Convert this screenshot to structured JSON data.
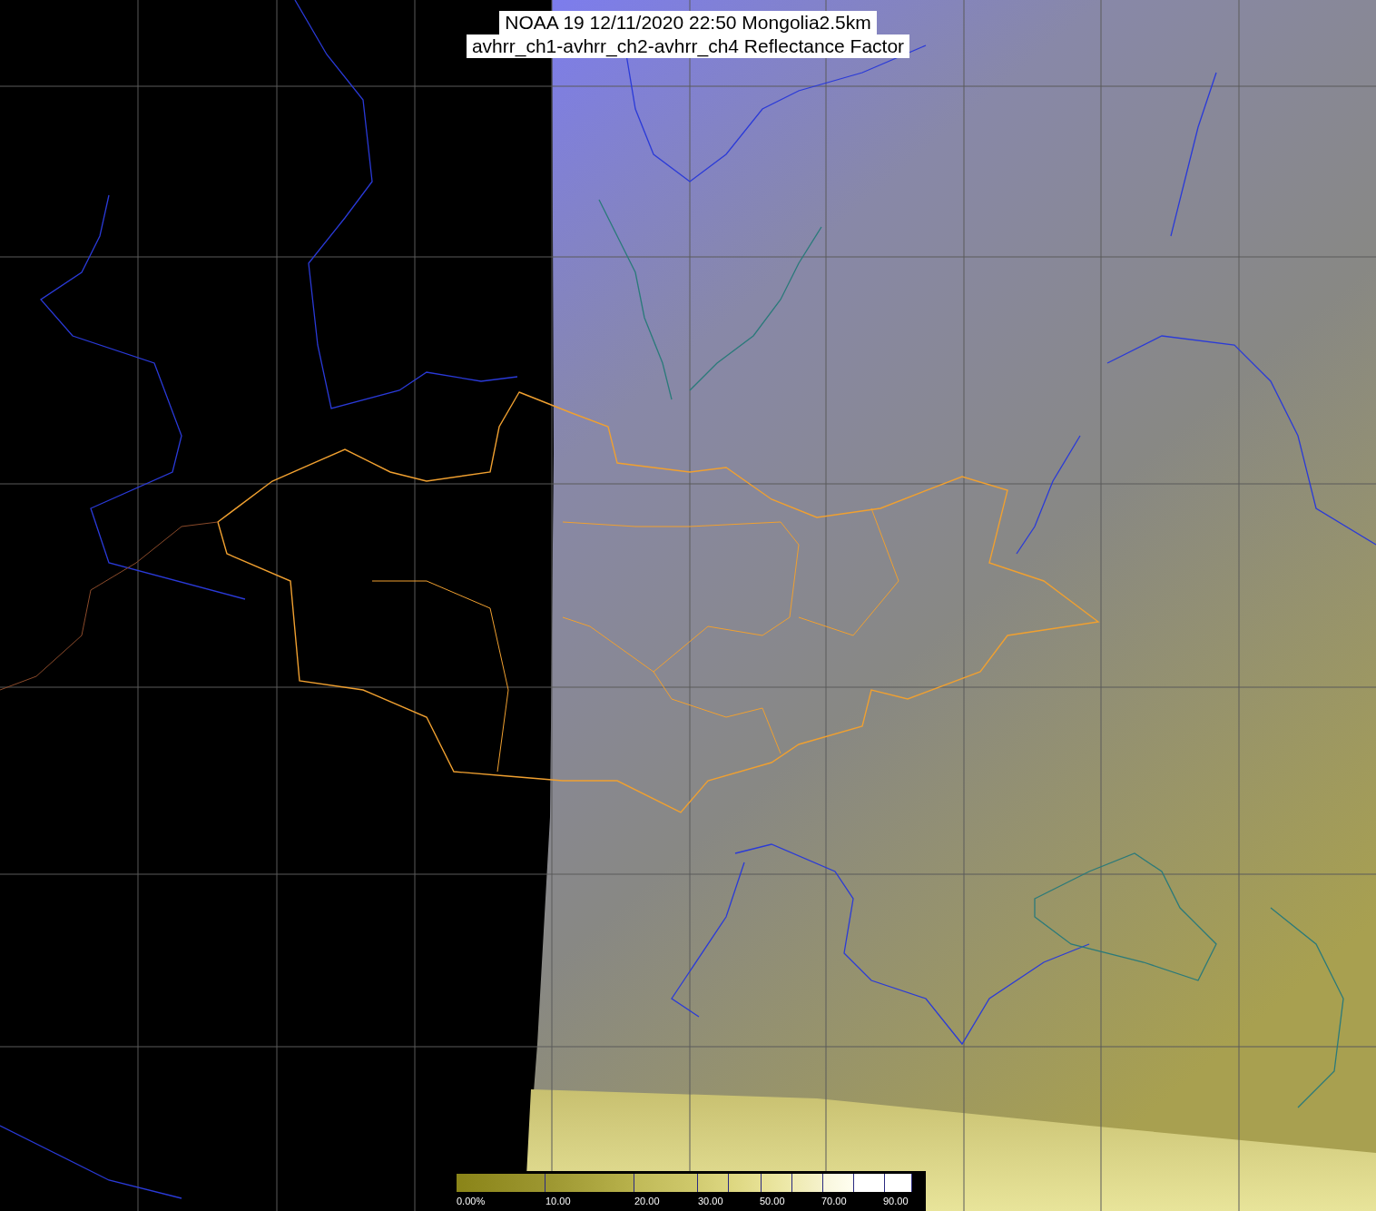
{
  "title": {
    "lines": [
      "NOAA 19 12/11/2020 22:50 Mongolia2.5km",
      "avhrr_ch1-avhrr_ch2-avhrr_ch4 Reflectance Factor"
    ]
  },
  "colorbar": {
    "labels": [
      "0.00%",
      "10.00",
      "20.00",
      "30.00",
      "50.00",
      "70.00",
      "90.00"
    ]
  }
}
